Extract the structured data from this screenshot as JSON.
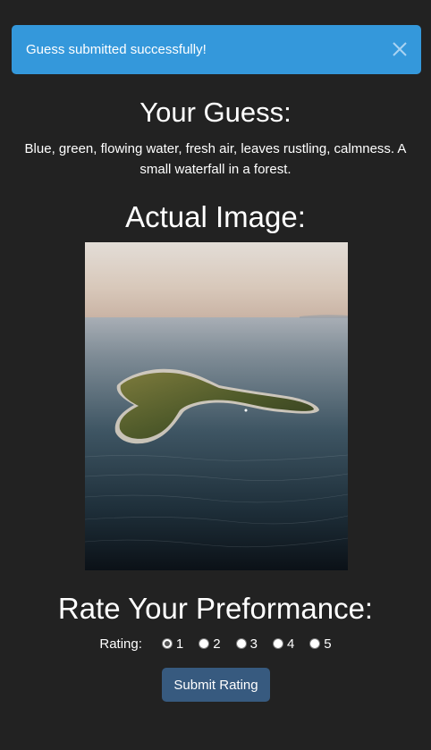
{
  "toast": {
    "message": "Guess submitted successfully!",
    "close_icon": "close-icon"
  },
  "guess": {
    "title": "Your Guess:",
    "text": "Blue, green, flowing water, fresh air, leaves rustling, calmness. A small waterfall in a forest."
  },
  "actual": {
    "title": "Actual Image:",
    "image_subject": "aerial photo of a small island in calm sea at dusk"
  },
  "rating": {
    "title": "Rate Your Preformance:",
    "label": "Rating:",
    "options": [
      "1",
      "2",
      "3",
      "4",
      "5"
    ],
    "selected": "1",
    "submit_label": "Submit Rating"
  },
  "colors": {
    "background": "#222222",
    "toast": "#3498db",
    "button": "#375a7f"
  }
}
